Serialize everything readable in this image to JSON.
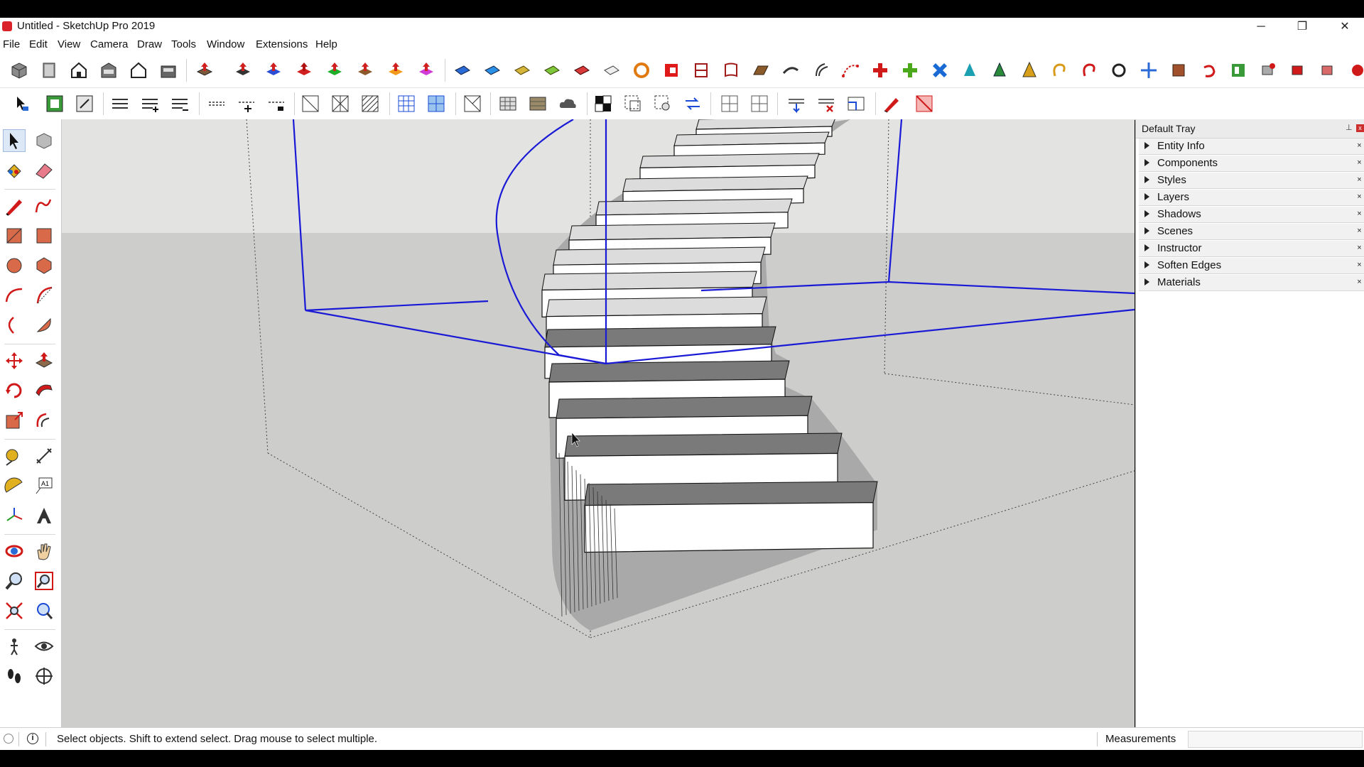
{
  "window": {
    "title": "Untitled - SketchUp Pro 2019",
    "minimize_icon": "─",
    "restore_icon": "❐",
    "close_icon": "✕"
  },
  "menu": [
    "File",
    "Edit",
    "View",
    "Camera",
    "Draw",
    "Tools",
    "Window",
    "Extensions",
    "Help"
  ],
  "tray": {
    "title": "Default Tray",
    "pin_icon": "⊥",
    "close_icon": "x",
    "panels": [
      "Entity Info",
      "Components",
      "Styles",
      "Layers",
      "Shadows",
      "Scenes",
      "Instructor",
      "Soften Edges",
      "Materials"
    ],
    "panel_close": "×"
  },
  "status": {
    "info_icon": "i",
    "message": "Select objects. Shift to extend select. Drag mouse to select multiple.",
    "measurements_label": "Measurements",
    "measurements_value": ""
  },
  "colors": {
    "axis_blue": "#1a1ad6",
    "ground": "#cdcdcb",
    "sky": "#e3e3e1",
    "brand_red": "#d9222a"
  }
}
